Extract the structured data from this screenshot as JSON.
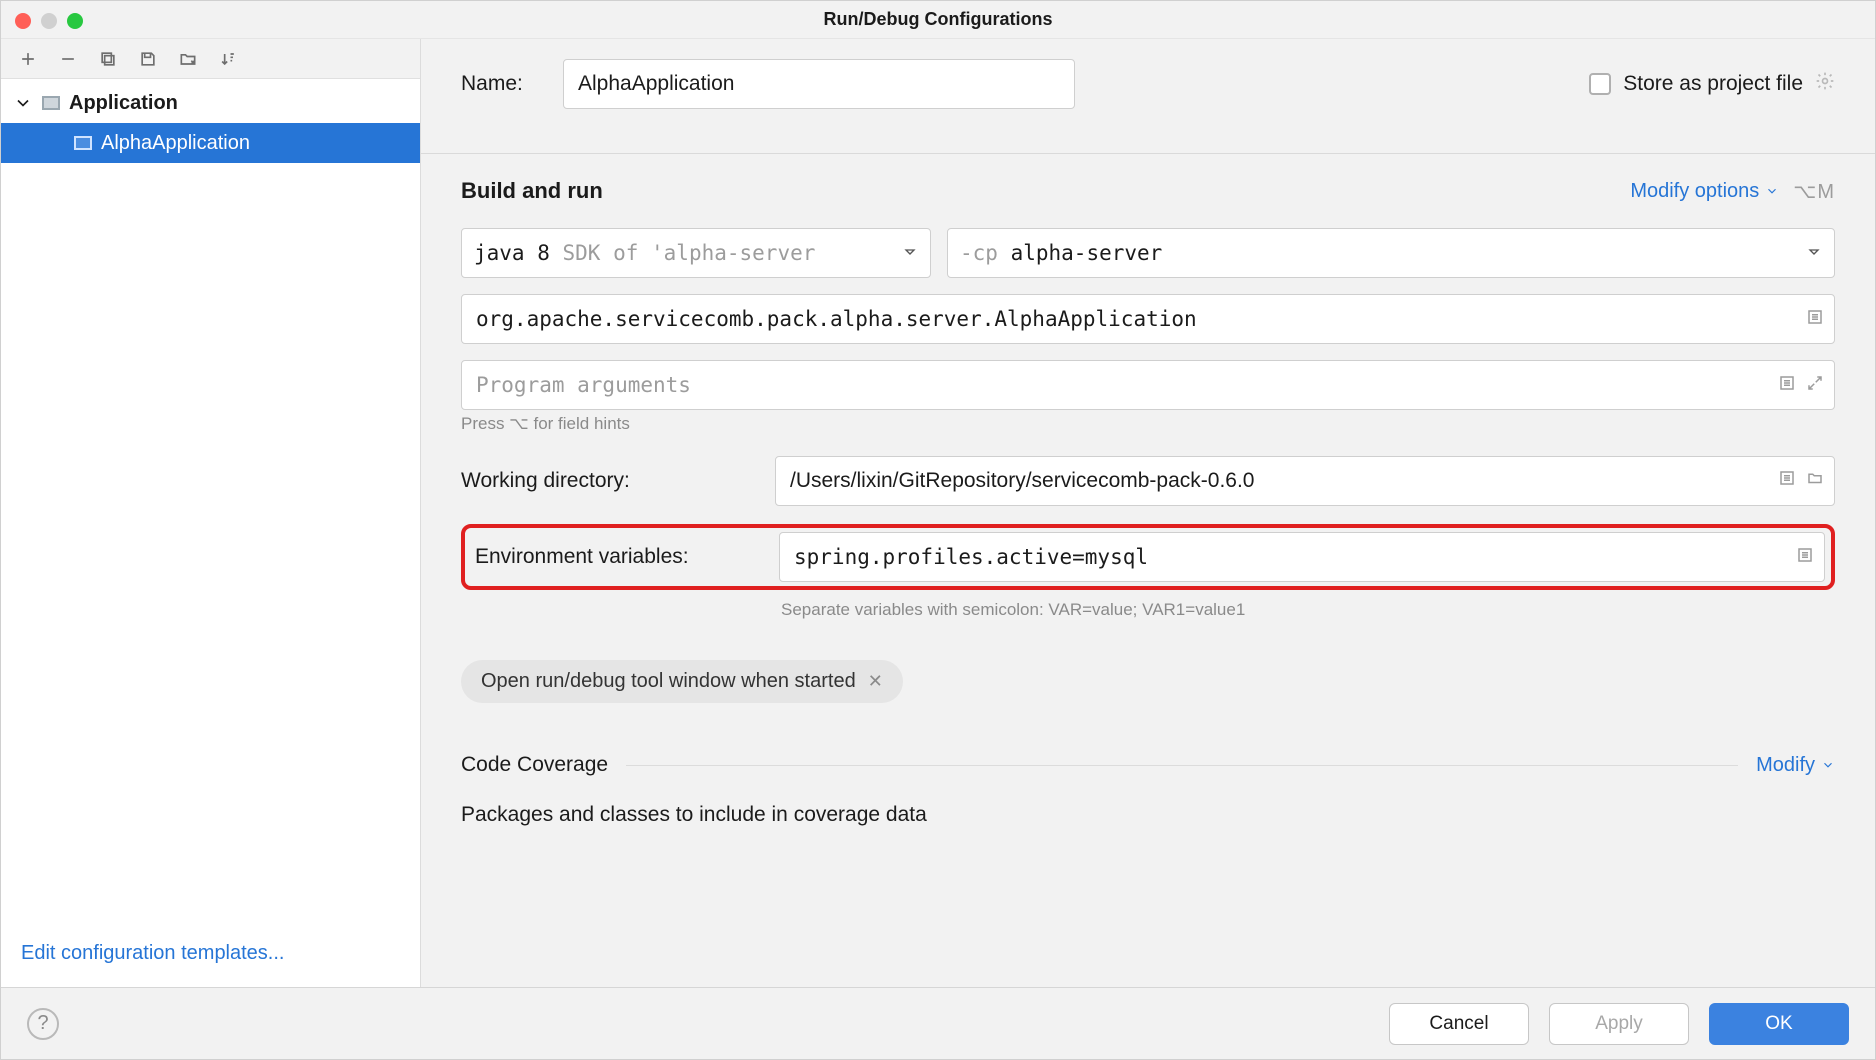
{
  "window": {
    "title": "Run/Debug Configurations"
  },
  "tree": {
    "parent_label": "Application",
    "child_label": "AlphaApplication"
  },
  "sidebar_footer_link": "Edit configuration templates...",
  "form": {
    "name_label": "Name:",
    "name_value": "AlphaApplication",
    "store_label": "Store as project file",
    "build_run_header": "Build and run",
    "modify_options_label": "Modify options",
    "modify_shortcut": "⌥M",
    "jdk_value": "java 8",
    "jdk_hint": "SDK of 'alpha-server",
    "cp_prefix": "-cp",
    "cp_value": "alpha-server",
    "main_class": "org.apache.servicecomb.pack.alpha.server.AlphaApplication",
    "program_args_placeholder": "Program arguments",
    "field_hints": "Press ⌥ for field hints",
    "working_dir_label": "Working directory:",
    "working_dir_value": "/Users/lixin/GitRepository/servicecomb-pack-0.6.0",
    "env_label": "Environment variables:",
    "env_value": "spring.profiles.active=mysql",
    "env_hint": "Separate variables with semicolon: VAR=value; VAR1=value1",
    "chip_label": "Open run/debug tool window when started",
    "code_coverage_header": "Code Coverage",
    "modify_label": "Modify",
    "coverage_packages_label": "Packages and classes to include in coverage data"
  },
  "footer": {
    "cancel": "Cancel",
    "apply": "Apply",
    "ok": "OK"
  }
}
